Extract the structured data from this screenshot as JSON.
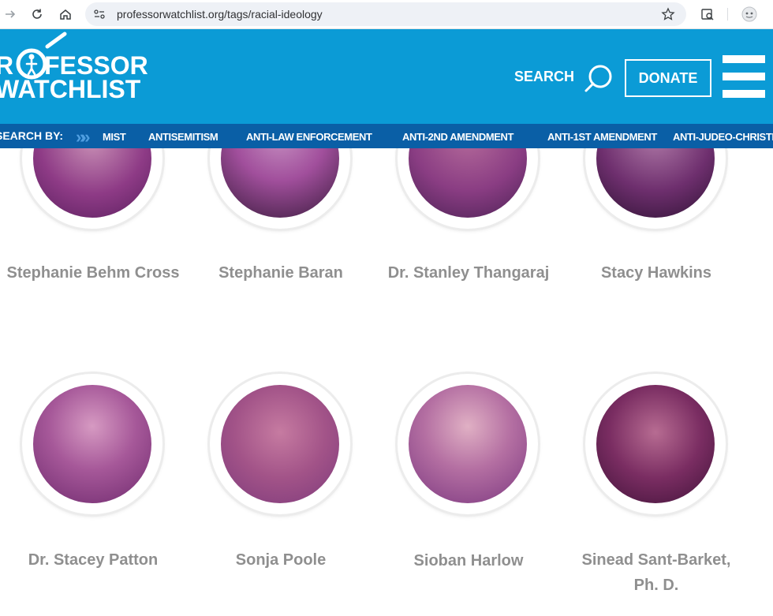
{
  "browser": {
    "url": "professorwatchlist.org/tags/racial-ideology"
  },
  "header": {
    "logo_line1": "ROFESSOR",
    "logo_line2": "WATCHLIST",
    "search_label": "SEARCH",
    "donate_label": "DONATE"
  },
  "catbar": {
    "label": "SEARCH BY:",
    "items": [
      "MIST",
      "ANTISEMITISM",
      "ANTI-LAW ENFORCEMENT",
      "ANTI-2ND AMENDMENT",
      "ANTI-1ST AMENDMENT",
      "ANTI-JUDEO-CHRISTIAN"
    ]
  },
  "profiles": [
    {
      "name": "Stephanie Behm Cross"
    },
    {
      "name": "Stephanie Baran"
    },
    {
      "name": "Dr. Stanley Thangaraj"
    },
    {
      "name": "Stacy Hawkins"
    },
    {
      "name": "Dr. Stacey Patton"
    },
    {
      "name": "Sonja Poole"
    },
    {
      "name": "Sioban Harlow"
    },
    {
      "name": "Sinead Sant-Barket, Ph. D."
    }
  ],
  "colors": {
    "header": "#0b9bd6",
    "catbar": "#0a5fa6",
    "name_text": "#8f8f8f"
  }
}
